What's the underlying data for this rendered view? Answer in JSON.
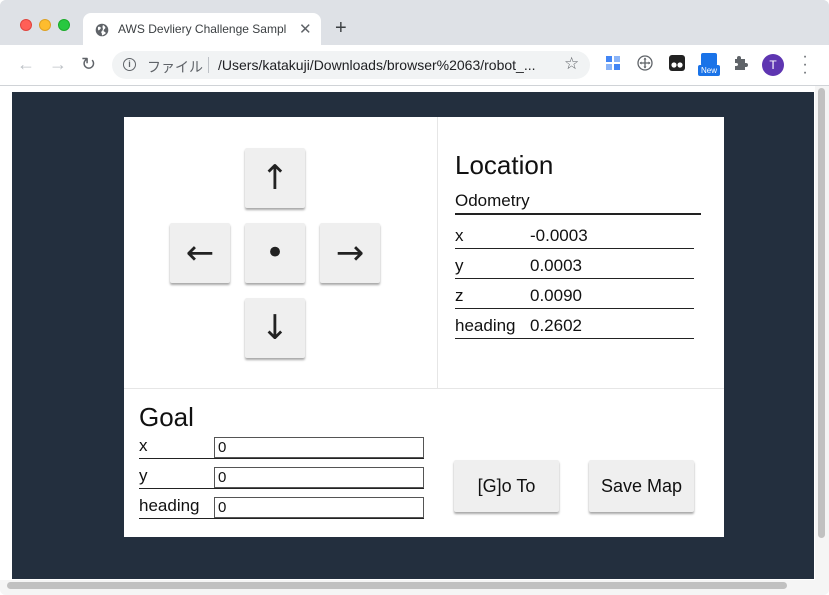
{
  "browser": {
    "tab_title": "AWS Devliery Challenge Sampl",
    "tab_close": "✕",
    "new_tab": "+",
    "back": "←",
    "forward": "→",
    "reload": "↻",
    "scheme_label": "ファイル",
    "url": "/Users/katakuji/Downloads/browser%2063/robot_...",
    "star": "☆",
    "avatar_letter": "T",
    "new_badge": "New"
  },
  "controls": {
    "up": "↑",
    "left": "←",
    "stop": "•",
    "right": "→",
    "down": "↓"
  },
  "location": {
    "title": "Location",
    "subtitle": "Odometry",
    "rows": [
      {
        "key": "x",
        "value": "-0.0003"
      },
      {
        "key": "y",
        "value": "0.0003"
      },
      {
        "key": "z",
        "value": "0.0090"
      },
      {
        "key": "heading",
        "value": "0.2602"
      }
    ]
  },
  "goal": {
    "title": "Goal",
    "fields": [
      {
        "label": "x",
        "value": "0"
      },
      {
        "label": "y",
        "value": "0"
      },
      {
        "label": "heading",
        "value": "0"
      }
    ],
    "goto_label": "[G]o To",
    "savemap_label": "Save Map"
  },
  "colors": {
    "page_background": "#232f3e",
    "panel": "#ffffff",
    "button": "#efefef"
  }
}
